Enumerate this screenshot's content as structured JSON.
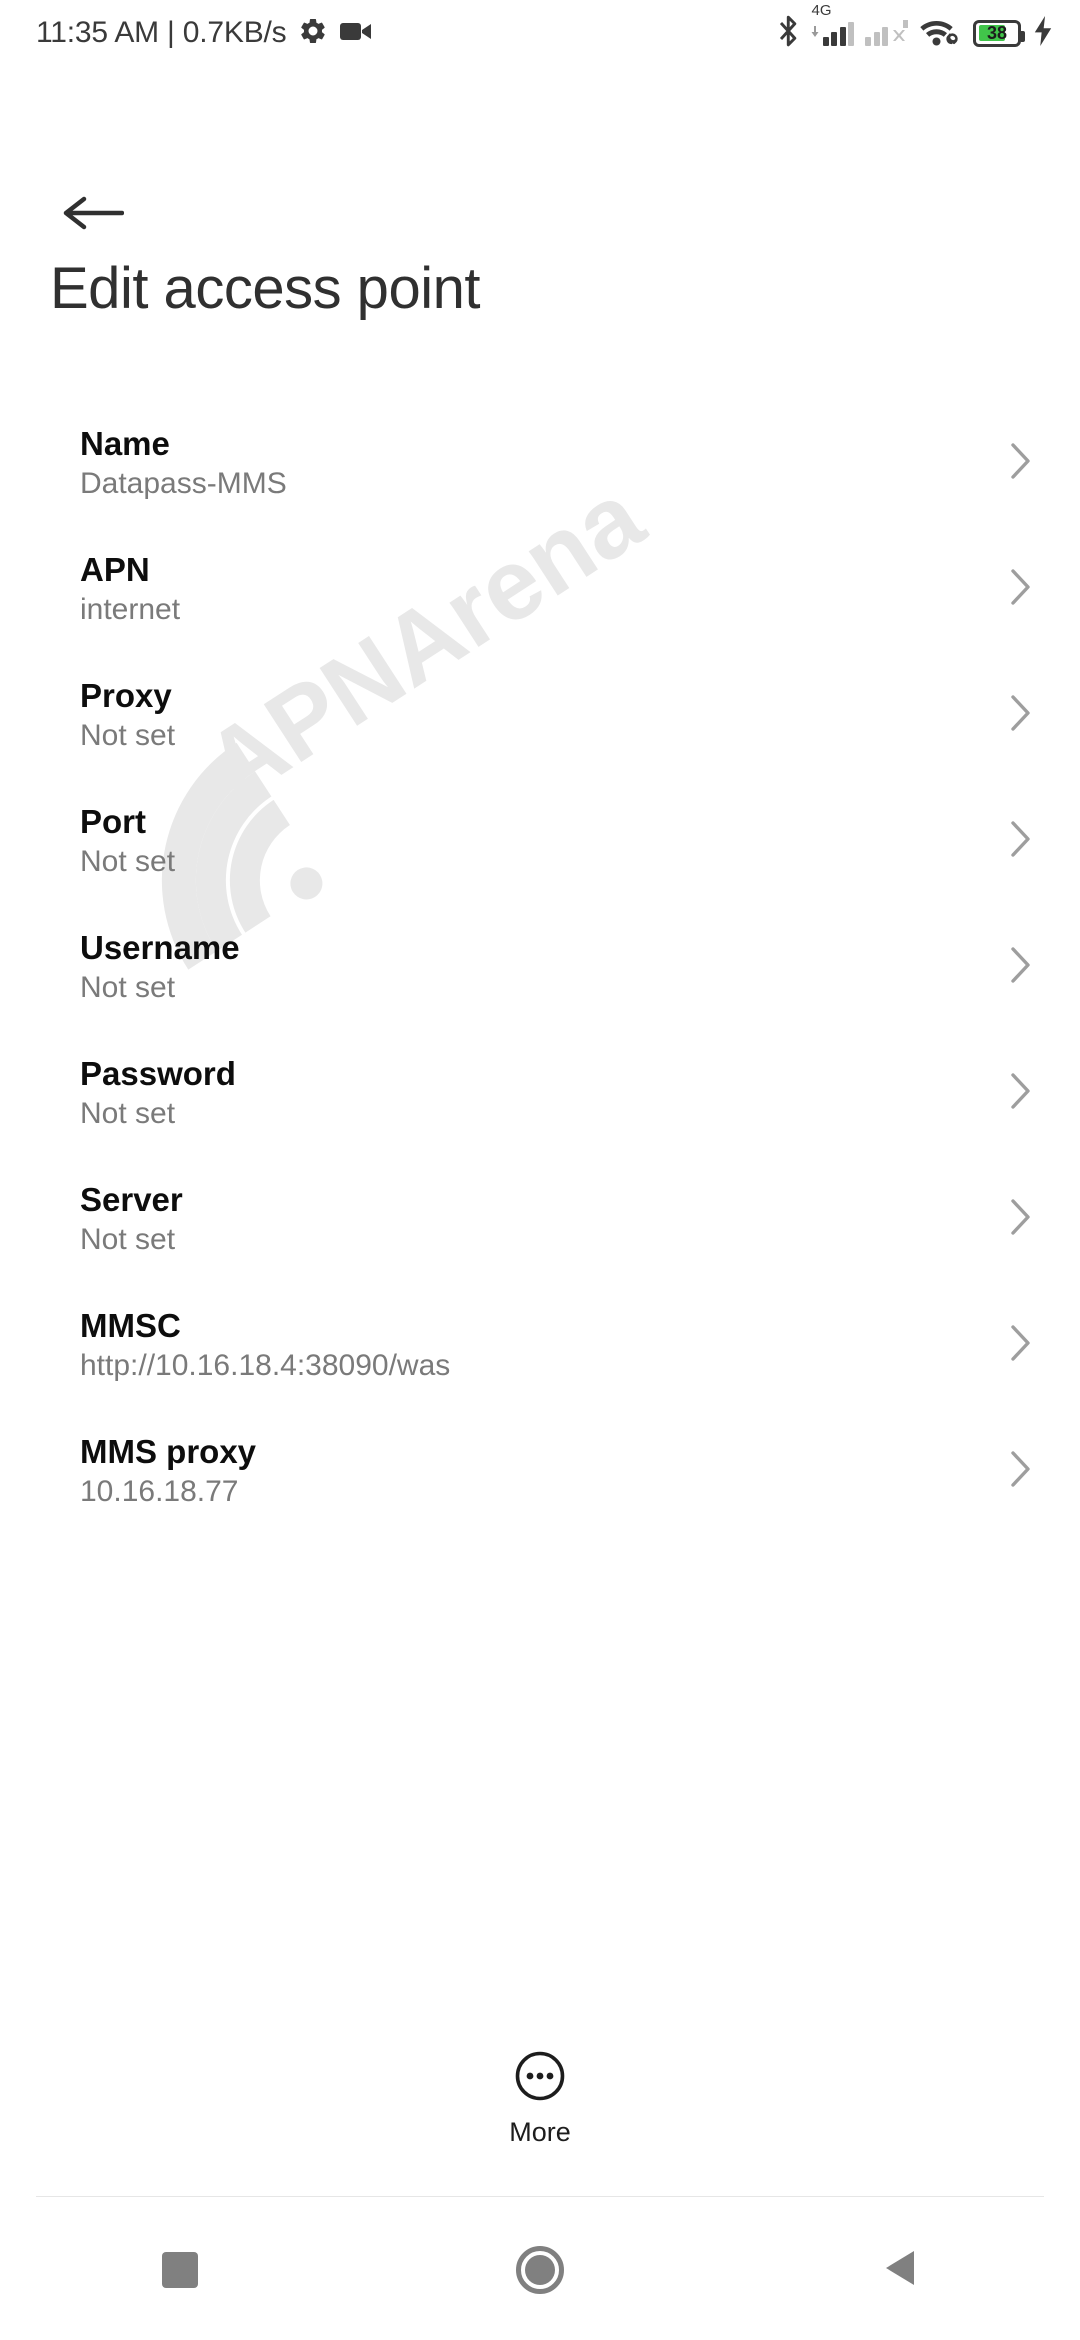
{
  "status_bar": {
    "clock_and_speed": "11:35 AM | 0.7KB/s",
    "icons_left": [
      "gear-icon",
      "video-camera-icon"
    ],
    "icons_right": [
      "bluetooth-icon",
      "signal-4g-icon",
      "signal-no-service-icon",
      "wifi-link-icon",
      "battery-icon",
      "charging-bolt-icon"
    ],
    "network_type": "4G",
    "battery_percent": "38",
    "battery_color": "#41c54a"
  },
  "header": {
    "back_label": "Back",
    "title": "Edit access point"
  },
  "watermark": {
    "text": "APNArena",
    "color": "#eaeaea"
  },
  "list": {
    "items": [
      {
        "label": "Name",
        "value": "Datapass-MMS"
      },
      {
        "label": "APN",
        "value": "internet"
      },
      {
        "label": "Proxy",
        "value": "Not set"
      },
      {
        "label": "Port",
        "value": "Not set"
      },
      {
        "label": "Username",
        "value": "Not set"
      },
      {
        "label": "Password",
        "value": "Not set"
      },
      {
        "label": "Server",
        "value": "Not set"
      },
      {
        "label": "MMSC",
        "value": "http://10.16.18.4:38090/was"
      },
      {
        "label": "MMS proxy",
        "value": "10.16.18.77"
      }
    ]
  },
  "more_button": {
    "label": "More",
    "icon": "more-circle-icon"
  },
  "nav_bar": {
    "recents_label": "Recents",
    "home_label": "Home",
    "back_label": "Back"
  },
  "colors": {
    "title": "#303030",
    "row_title": "#0d0d0d",
    "row_value": "#7a7a7a",
    "chevron": "#9e9e9e",
    "nav": "#808080"
  }
}
